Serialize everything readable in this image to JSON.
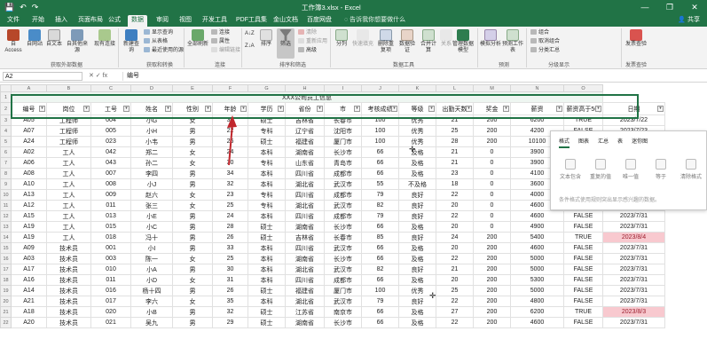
{
  "window": {
    "title": "工作簿3.xlsx - Excel",
    "search_placeholder": "告诉我你想要做什么",
    "share": "共享",
    "minimize": "—",
    "restore": "❐",
    "close": "✕"
  },
  "tabs": [
    "文件",
    "开始",
    "插入",
    "页面布局",
    "公式",
    "数据",
    "审阅",
    "视图",
    "开发工具",
    "PDF工具集",
    "金山文档",
    "百度网盘"
  ],
  "active_tab": "数据",
  "ribbon": {
    "get_external": [
      "自 Access",
      "自网站",
      "自文本",
      "自其他来源",
      "现有连接"
    ],
    "new_query": "新建查询",
    "query_small": [
      "显示查询",
      "从表格",
      "最近使用的源"
    ],
    "refresh": "全部刷新",
    "conn_small": [
      "连接",
      "属性",
      "编辑链接"
    ],
    "sort_az": "A↓Z",
    "sort_za": "Z↓A",
    "sort": "排序",
    "filter": "筛选",
    "filter_small": [
      "清除",
      "重新应用",
      "高级"
    ],
    "tools": [
      "分列",
      "快速填充",
      "删除重复项",
      "数据验证",
      "合并计算",
      "关系",
      "管理数据模型"
    ],
    "forecast": [
      "模拟分析",
      "预测工作表"
    ],
    "outline": [
      "组合",
      "取消组合",
      "分类汇总"
    ],
    "invoice": "发票查验",
    "groups": [
      "获取外部数据",
      "获取和转换",
      "连接",
      "排序和筛选",
      "数据工具",
      "预测",
      "分级显示",
      "发票查验"
    ]
  },
  "formula_bar": {
    "cell": "A2",
    "fx": "fx",
    "value": "编号"
  },
  "sheet": {
    "columns": [
      "",
      "A",
      "B",
      "C",
      "D",
      "E",
      "F",
      "G",
      "H",
      "I",
      "J",
      "K",
      "L",
      "M",
      "N",
      "O"
    ],
    "title": "XXX公司员工信息",
    "headers": [
      "编号",
      "岗位",
      "工号",
      "姓名",
      "性别",
      "年龄",
      "学历",
      "省份",
      "市",
      "考核成绩",
      "等级",
      "出勤天数",
      "奖金",
      "薪资",
      "薪资高于50(",
      "日期"
    ],
    "rows": [
      [
        "A05",
        "工程师",
        "004",
        "小G",
        "女",
        "30",
        "硕士",
        "吉林省",
        "长春市",
        "100",
        "优秀",
        "21",
        "200",
        "6200",
        "TRUE",
        "2023/7/22"
      ],
      [
        "A07",
        "工程师",
        "005",
        "小H",
        "男",
        "22",
        "专科",
        "辽宁省",
        "沈阳市",
        "100",
        "优秀",
        "25",
        "200",
        "4200",
        "FALSE",
        "2023/7/23"
      ],
      [
        "A24",
        "工程师",
        "023",
        "小韦",
        "男",
        "26",
        "硕士",
        "福建省",
        "厦门市",
        "100",
        "优秀",
        "28",
        "200",
        "10100",
        "",
        ""
      ],
      [
        "A02",
        "工人",
        "042",
        "郑二",
        "女",
        "24",
        "本科",
        "湖南省",
        "长沙市",
        "66",
        "及格",
        "21",
        "0",
        "3900",
        "",
        ""
      ],
      [
        "A06",
        "工人",
        "043",
        "孙二",
        "女",
        "30",
        "专科",
        "山东省",
        "青岛市",
        "66",
        "及格",
        "21",
        "0",
        "3900",
        "",
        ""
      ],
      [
        "A08",
        "工人",
        "007",
        "李四",
        "男",
        "34",
        "本科",
        "四川省",
        "成都市",
        "66",
        "及格",
        "23",
        "0",
        "4100",
        "",
        ""
      ],
      [
        "A10",
        "工人",
        "008",
        "小J",
        "男",
        "32",
        "本科",
        "湖北省",
        "武汉市",
        "55",
        "不及格",
        "18",
        "0",
        "3600",
        "",
        ""
      ],
      [
        "A13",
        "工人",
        "009",
        "赵六",
        "女",
        "23",
        "专科",
        "四川省",
        "成都市",
        "79",
        "良好",
        "22",
        "0",
        "4000",
        "FALSE",
        "2023/7/31"
      ],
      [
        "A12",
        "工人",
        "011",
        "张三",
        "女",
        "25",
        "专科",
        "湖北省",
        "武汉市",
        "82",
        "良好",
        "20",
        "0",
        "4600",
        "FALSE",
        "2023/7/31"
      ],
      [
        "A15",
        "工人",
        "013",
        "小E",
        "男",
        "24",
        "本科",
        "四川省",
        "成都市",
        "79",
        "良好",
        "22",
        "0",
        "4600",
        "FALSE",
        "2023/7/31"
      ],
      [
        "A19",
        "工人",
        "015",
        "小C",
        "男",
        "28",
        "硕士",
        "湖南省",
        "长沙市",
        "66",
        "及格",
        "20",
        "0",
        "4900",
        "FALSE",
        "2023/7/31"
      ],
      [
        "A19",
        "工人",
        "018",
        "冯十",
        "男",
        "26",
        "硕士",
        "吉林省",
        "长春市",
        "85",
        "良好",
        "24",
        "200",
        "5400",
        "TRUE",
        "2023/8/4"
      ],
      [
        "A09",
        "技术员",
        "001",
        "小I",
        "男",
        "33",
        "本科",
        "四川省",
        "武汉市",
        "66",
        "及格",
        "20",
        "200",
        "4600",
        "FALSE",
        "2023/7/31"
      ],
      [
        "A03",
        "技术员",
        "003",
        "陈一",
        "女",
        "25",
        "本科",
        "湖南省",
        "长沙市",
        "66",
        "及格",
        "22",
        "200",
        "5000",
        "FALSE",
        "2023/7/31"
      ],
      [
        "A17",
        "技术员",
        "010",
        "小A",
        "男",
        "30",
        "本科",
        "湖北省",
        "武汉市",
        "82",
        "良好",
        "21",
        "200",
        "5000",
        "FALSE",
        "2023/7/31"
      ],
      [
        "A16",
        "技术员",
        "011",
        "小D",
        "女",
        "31",
        "本科",
        "四川省",
        "成都市",
        "66",
        "及格",
        "20",
        "200",
        "5300",
        "FALSE",
        "2023/7/31"
      ],
      [
        "A14",
        "技术员",
        "016",
        "杨十四",
        "男",
        "26",
        "硕士",
        "福建省",
        "厦门市",
        "100",
        "优秀",
        "25",
        "200",
        "5000",
        "FALSE",
        "2023/7/31"
      ],
      [
        "A21",
        "技术员",
        "017",
        "李六",
        "女",
        "35",
        "本科",
        "湖北省",
        "武汉市",
        "79",
        "良好",
        "22",
        "200",
        "4800",
        "FALSE",
        "2023/7/31"
      ],
      [
        "A18",
        "技术员",
        "020",
        "小B",
        "男",
        "32",
        "硕士",
        "江苏省",
        "南京市",
        "66",
        "及格",
        "27",
        "200",
        "6200",
        "TRUE",
        "2023/8/3"
      ],
      [
        "A20",
        "技术员",
        "021",
        "吴九",
        "男",
        "29",
        "硕士",
        "湖南省",
        "长沙市",
        "66",
        "及格",
        "22",
        "200",
        "4600",
        "FALSE",
        "2023/7/31"
      ]
    ],
    "pink_dates": [
      "2023/8/4",
      "2023/8/3"
    ]
  },
  "quick_analysis": {
    "tabs": [
      "格式",
      "图表",
      "汇总",
      "表",
      "迷你图"
    ],
    "items": [
      "文本包含",
      "重复的值",
      "唯一值",
      "等于",
      "清除格式"
    ],
    "description": "条件格式使用规则突出显示感兴趣的数据。"
  },
  "colors": {
    "accent": "#217346",
    "pink": "#f8c9cf",
    "arrow": "#c1272d"
  }
}
